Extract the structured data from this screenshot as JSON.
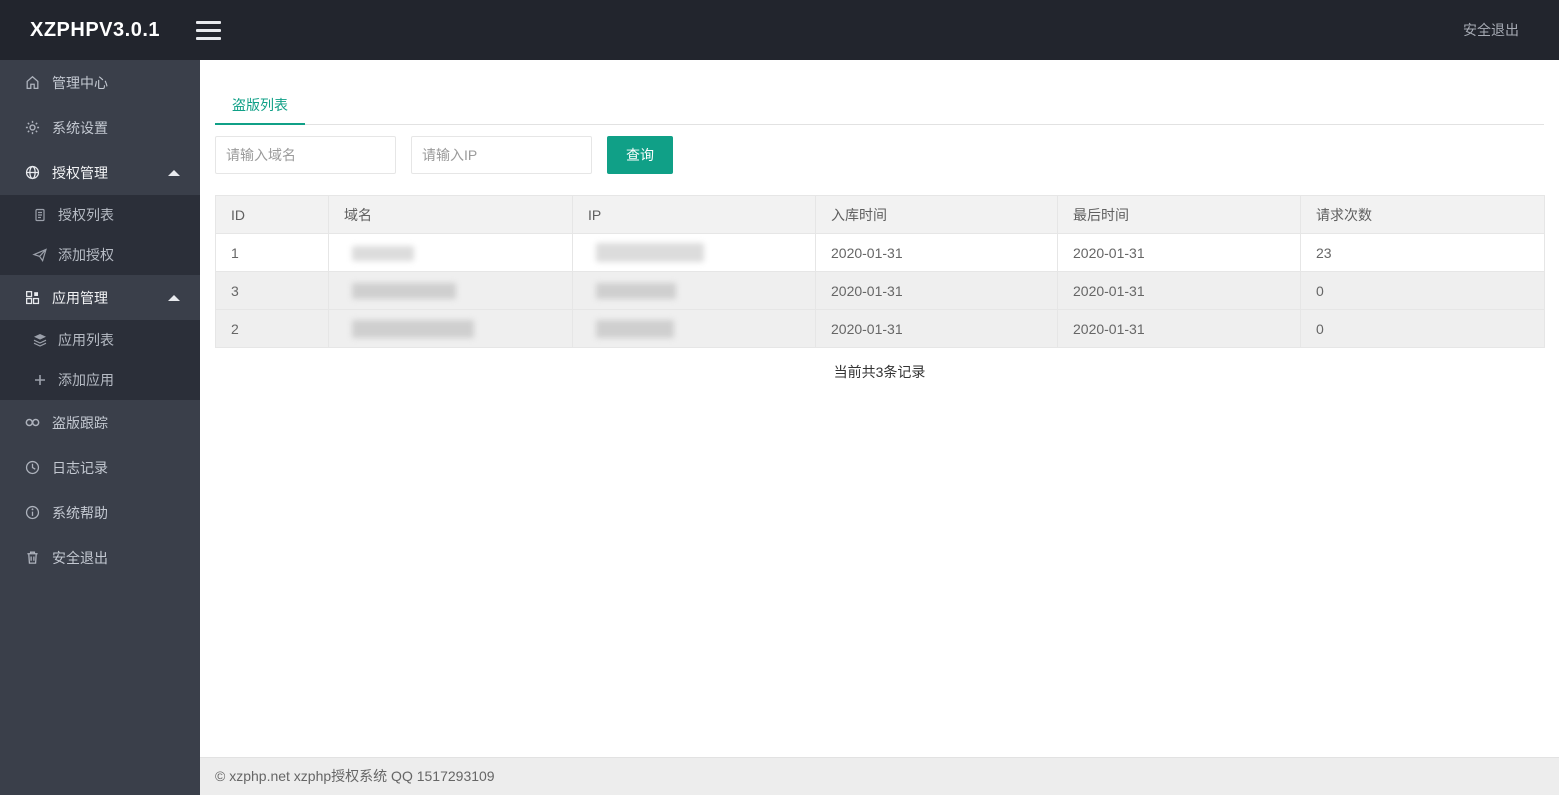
{
  "colors": {
    "accent": "#10a087",
    "header_bg": "#22252d",
    "sidebar_bg": "#3a3f4a",
    "submenu_bg": "#2b2f39",
    "stripe_row_bg": "#efefef",
    "table_header_bg": "#f2f2f2"
  },
  "header": {
    "brand": "XZPHPV3.0.1",
    "logout_label": "安全退出"
  },
  "sidebar": {
    "items": [
      {
        "label": "管理中心",
        "icon": "home-icon"
      },
      {
        "label": "系统设置",
        "icon": "gear-icon"
      },
      {
        "label": "授权管理",
        "icon": "globe-icon",
        "expanded": true
      },
      {
        "label": "授权列表",
        "icon": "document-icon",
        "sub": true
      },
      {
        "label": "添加授权",
        "icon": "send-icon",
        "sub": true
      },
      {
        "label": "应用管理",
        "icon": "apps-icon",
        "expanded": true
      },
      {
        "label": "应用列表",
        "icon": "layers-icon",
        "sub": true
      },
      {
        "label": "添加应用",
        "icon": "plus-icon",
        "sub": true
      },
      {
        "label": "盗版跟踪",
        "icon": "infinity-icon"
      },
      {
        "label": "日志记录",
        "icon": "clock-icon"
      },
      {
        "label": "系统帮助",
        "icon": "info-icon"
      },
      {
        "label": "安全退出",
        "icon": "trash-icon"
      }
    ]
  },
  "main": {
    "tab": "盗版列表",
    "search": {
      "domain_placeholder": "请输入域名",
      "ip_placeholder": "请输入IP",
      "submit_label": "查询"
    },
    "table": {
      "columns": [
        "ID",
        "域名",
        "IP",
        "入库时间",
        "最后时间",
        "请求次数"
      ],
      "rows": [
        {
          "id": "1",
          "domain_redacted": true,
          "ip_redacted": true,
          "entry_time": "2020-01-31",
          "last_time": "2020-01-31",
          "request_count": "23"
        },
        {
          "id": "3",
          "domain_redacted": true,
          "ip_redacted": true,
          "entry_time": "2020-01-31",
          "last_time": "2020-01-31",
          "request_count": "0"
        },
        {
          "id": "2",
          "domain_redacted": true,
          "ip_redacted": true,
          "entry_time": "2020-01-31",
          "last_time": "2020-01-31",
          "request_count": "0"
        }
      ]
    },
    "summary": "当前共3条记录"
  },
  "footer": {
    "copyright": "© xzphp.net xzphp授权系统 QQ 1517293109"
  }
}
